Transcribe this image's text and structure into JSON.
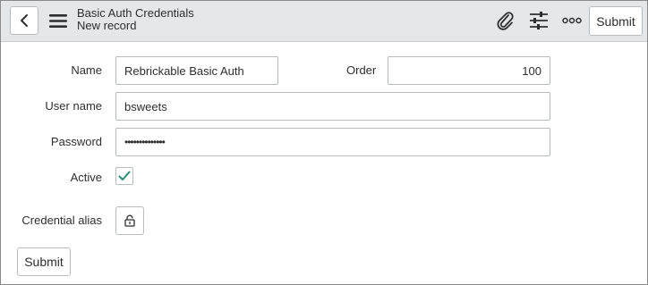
{
  "header": {
    "title": "Basic Auth Credentials",
    "subtitle": "New record",
    "submit_label": "Submit",
    "icons": [
      "back-icon",
      "menu-icon",
      "paperclip-icon",
      "sliders-icon",
      "more-icon"
    ]
  },
  "form": {
    "name_label": "Name",
    "name_value": "Rebrickable Basic Auth",
    "order_label": "Order",
    "order_value": "100",
    "username_label": "User name",
    "username_value": "bsweets",
    "password_label": "Password",
    "password_value": "••••••••••••••",
    "active_label": "Active",
    "active_checked": true,
    "alias_label": "Credential alias",
    "submit_label": "Submit"
  },
  "colors": {
    "header_bg": "#e4e6e7",
    "check": "#278c77"
  }
}
